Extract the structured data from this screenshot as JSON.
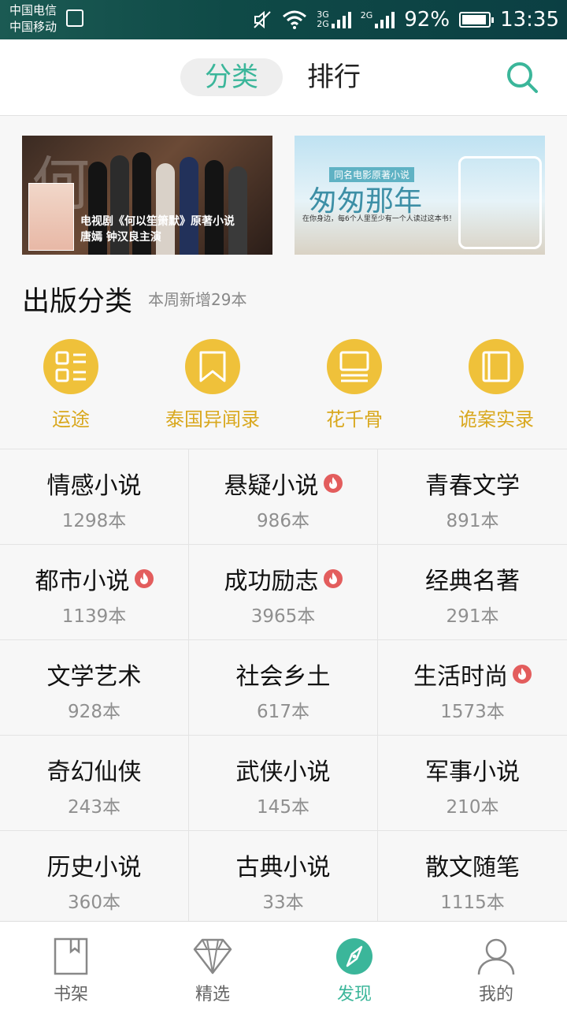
{
  "status_bar": {
    "carrier_1": "中国电信",
    "carrier_2": "中国移动",
    "net_3g": "3G",
    "net_2g_a": "2G",
    "net_2g_b": "2G",
    "battery": "92%",
    "battery_level": 0.92,
    "time": "13:35"
  },
  "header": {
    "tab_category": "分类",
    "tab_ranking": "排行",
    "accent": "#3bb69a"
  },
  "banners": [
    {
      "title": "电视剧《何以笙箫默》原著小说",
      "subtitle": "唐嫣 钟汉良主演"
    },
    {
      "tag": "同名电影原著小说",
      "title": "匆匆那年",
      "subtitle": "在你身边，每6个人里至少有一个人读过这本书！"
    }
  ],
  "section": {
    "title": "出版分类",
    "subtitle": "本周新增29本"
  },
  "featured": [
    {
      "label": "运途",
      "icon": "list-icon"
    },
    {
      "label": "泰国异闻录",
      "icon": "bookmark-icon"
    },
    {
      "label": "花千骨",
      "icon": "layout-icon"
    },
    {
      "label": "诡案实录",
      "icon": "book-icon"
    }
  ],
  "categories": [
    {
      "name": "情感小说",
      "count": "1298本",
      "hot": false
    },
    {
      "name": "悬疑小说",
      "count": "986本",
      "hot": true
    },
    {
      "name": "青春文学",
      "count": "891本",
      "hot": false
    },
    {
      "name": "都市小说",
      "count": "1139本",
      "hot": true
    },
    {
      "name": "成功励志",
      "count": "3965本",
      "hot": true
    },
    {
      "name": "经典名著",
      "count": "291本",
      "hot": false
    },
    {
      "name": "文学艺术",
      "count": "928本",
      "hot": false
    },
    {
      "name": "社会乡土",
      "count": "617本",
      "hot": false
    },
    {
      "name": "生活时尚",
      "count": "1573本",
      "hot": true
    },
    {
      "name": "奇幻仙侠",
      "count": "243本",
      "hot": false
    },
    {
      "name": "武侠小说",
      "count": "145本",
      "hot": false
    },
    {
      "name": "军事小说",
      "count": "210本",
      "hot": false
    },
    {
      "name": "历史小说",
      "count": "360本",
      "hot": false
    },
    {
      "name": "古典小说",
      "count": "33本",
      "hot": false
    },
    {
      "name": "散文随笔",
      "count": "1115本",
      "hot": false
    }
  ],
  "bottom_nav": [
    {
      "label": "书架",
      "icon": "bookshelf-icon",
      "active": false
    },
    {
      "label": "精选",
      "icon": "diamond-icon",
      "active": false
    },
    {
      "label": "发现",
      "icon": "compass-icon",
      "active": true
    },
    {
      "label": "我的",
      "icon": "person-icon",
      "active": false
    }
  ],
  "colors": {
    "accent": "#3bb69a",
    "featured_yellow": "#efc13a",
    "hot_red": "#e35d5d"
  }
}
